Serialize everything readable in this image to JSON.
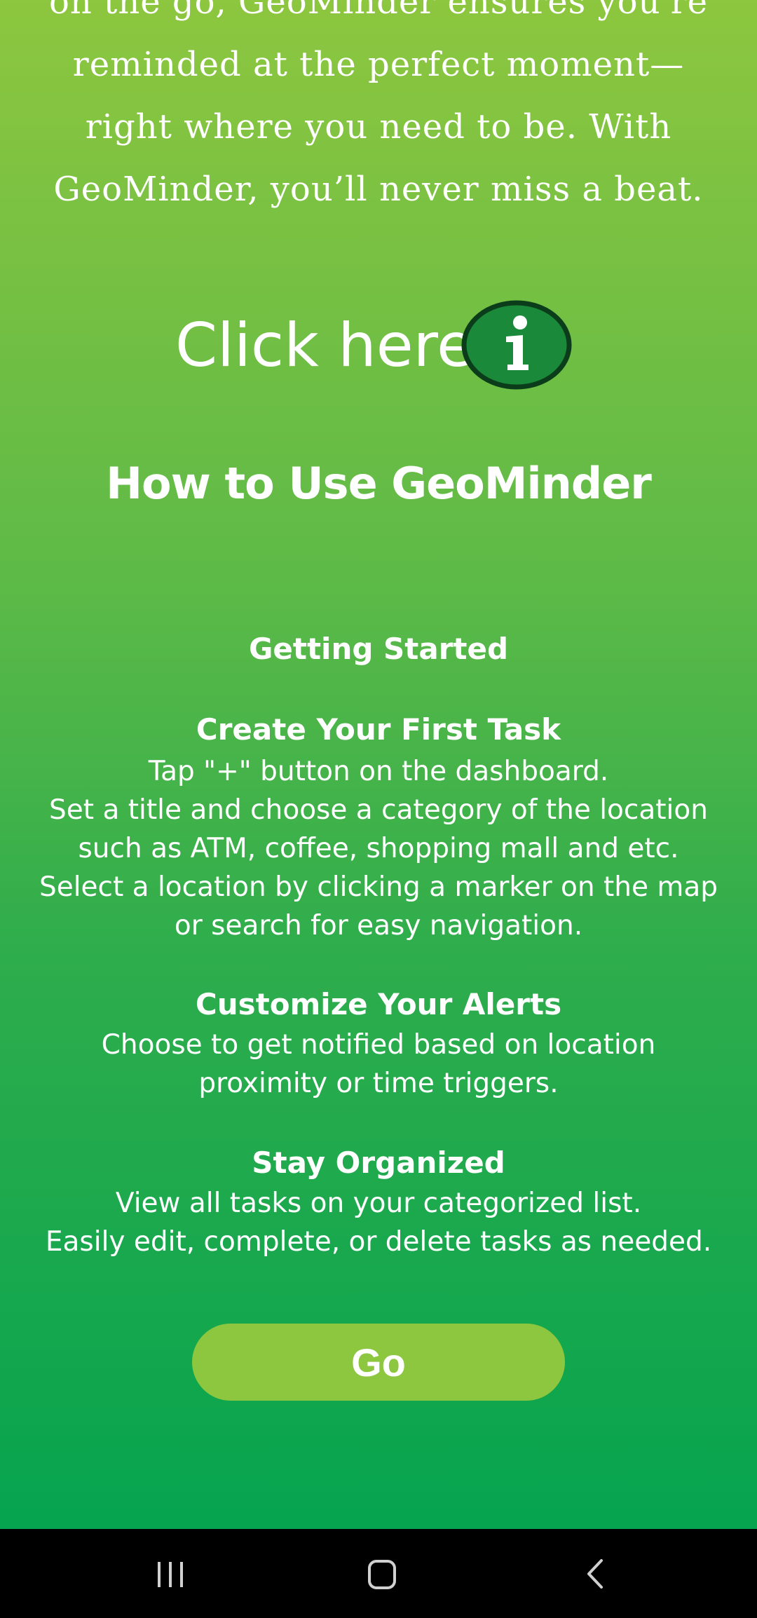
{
  "intro": {
    "lines": [
      "on the go, GeoMinder ensures you're",
      "reminded at the perfect moment—",
      "right where you need to be. With",
      "GeoMinder, you’ll never miss a beat."
    ]
  },
  "info": {
    "click_label": "Click here",
    "icon": "info-icon",
    "icon_color": "#1a8a3a"
  },
  "guide": {
    "title": "How to Use GeoMinder",
    "getting_started": "Getting Started",
    "sections": [
      {
        "title": "Create Your First Task",
        "lines": [
          "Tap \"+\" button on the dashboard.",
          "Set a title and choose a category of the location",
          "such as ATM, coffee, shopping mall and etc.",
          "Select a location by clicking a marker on the map",
          "or search for easy navigation."
        ]
      },
      {
        "title": "Customize Your Alerts",
        "lines": [
          "Choose to get notified based on location",
          "proximity or time triggers."
        ]
      },
      {
        "title": "Stay Organized",
        "lines": [
          "View all tasks on your categorized list.",
          "Easily edit, complete, or delete tasks as needed."
        ]
      }
    ]
  },
  "actions": {
    "go_label": "Go",
    "go_color": "#8dc63f"
  },
  "navbar": {
    "recents_icon": "recent-apps-icon",
    "home_icon": "home-icon",
    "back_icon": "back-icon"
  },
  "colors": {
    "gradient_top": "#8dc63f",
    "gradient_bottom": "#06a44f",
    "text": "#ffffff"
  }
}
